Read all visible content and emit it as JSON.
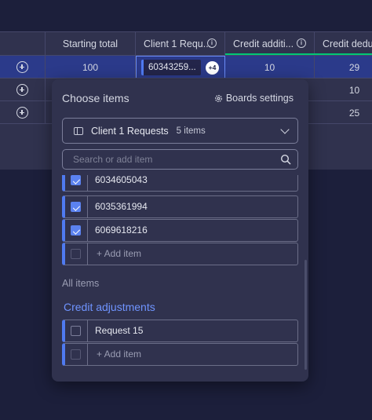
{
  "table": {
    "columns": {
      "starting_total": "Starting total",
      "client_requests": "Client 1 Requ...",
      "credit_additions": "Credit additi...",
      "credit_deductions": "Credit deduc"
    },
    "rows": [
      {
        "starting_total": "100",
        "credit_additions": "10",
        "credit_deductions": "29",
        "connected_item": "60343259...",
        "more_count": "+4"
      },
      {
        "starting_total": "",
        "credit_additions": "",
        "credit_deductions": "10"
      },
      {
        "starting_total": "",
        "credit_additions": "",
        "credit_deductions": "25"
      }
    ],
    "accent_colors": {
      "selection": "#2b3a8a",
      "group_line": "#00c875"
    }
  },
  "popover": {
    "title": "Choose items",
    "boards_settings_label": "Boards settings",
    "board": {
      "name": "Client 1 Requests",
      "count_label": "5 items"
    },
    "search_placeholder": "Search or add item",
    "selected_items": [
      {
        "label": "6034605043",
        "checked": true
      },
      {
        "label": "6035361994",
        "checked": true
      },
      {
        "label": "6069618216",
        "checked": true
      }
    ],
    "add_item_label": "+ Add item",
    "all_items_label": "All items",
    "group_name": "Credit adjustments",
    "group_items": [
      {
        "label": "Request 15",
        "checked": false
      }
    ],
    "group_add_item_label": "+ Add item",
    "accent_color": "#6f94ff"
  }
}
